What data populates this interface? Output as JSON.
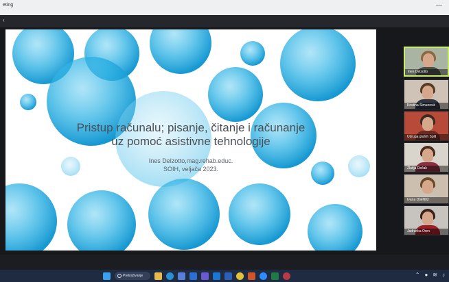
{
  "window": {
    "title": "eting",
    "minimize_glyph": "—",
    "back_glyph": "‹"
  },
  "slide": {
    "title_line1": "Pristup računalu; pisanje, čitanje i računanje",
    "title_line2": "uz pomoć asistivne tehnologije",
    "author": "Ines Delzotto,mag.rehab.educ.",
    "org_date": "SOIH, veljača 2023."
  },
  "participants": [
    {
      "name": "Ines Delzotto",
      "active": true
    },
    {
      "name": "Kristina Šimunović",
      "active": false
    },
    {
      "name": "Udruga gluhih Split",
      "active": false
    },
    {
      "name": "Zlatija Dečak",
      "active": false
    },
    {
      "name": "Ivana DGIN02",
      "active": false
    },
    {
      "name": "Jadranka Oren",
      "active": false
    }
  ],
  "taskbar": {
    "search_label": "Pretraživanje",
    "start_icon": "windows-start-icon",
    "apps": [
      "file-explorer-icon",
      "edge-icon",
      "store-icon",
      "mail-icon",
      "teams-icon",
      "outlook-icon",
      "word-icon",
      "chrome-icon",
      "powerpoint-icon",
      "zoom-icon",
      "excel-icon",
      "settings-icon"
    ],
    "tray_icons": [
      "chevron-up-icon",
      "mic-icon",
      "wifi-icon",
      "speaker-icon"
    ]
  },
  "colors": {
    "accent_bubble": "#2aa7dc",
    "active_border": "#c9ec6a",
    "taskbar": "#1f2b40"
  }
}
